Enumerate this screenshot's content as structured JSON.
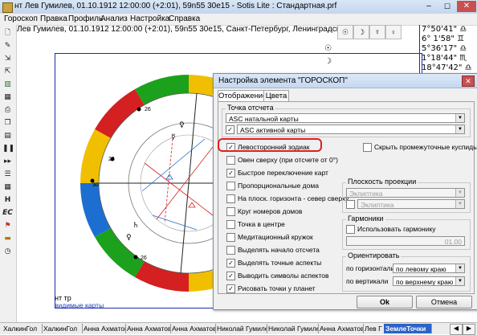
{
  "window": {
    "title": "нт Лев Гумилев, 01.10.1912 12:00:00 (+2:01), 59n55 30e15 - Sotis Lite : Стандартная.prf",
    "controls": [
      "minimize",
      "maximize",
      "close"
    ]
  },
  "menu": [
    "Гороскоп",
    "Правка",
    "Профиль",
    "Анализ",
    "Настройка",
    "Справка"
  ],
  "header": {
    "chart_info": "Лев Гумилев, 01.10.1912 12:00:00 (+2:01), 59n55 30e15, Санкт-Петербург, Ленинградская обл., Рос"
  },
  "chart": {
    "footer_title": "нт тр",
    "footer_sub": "видимые карты",
    "planet_labels": [
      "26",
      "26",
      "30",
      "26"
    ]
  },
  "right_panel": {
    "header_symbols": [
      "☉",
      "☽",
      "☿",
      "♀"
    ],
    "rows": [
      {
        "glyph": "☉",
        "pos": "7°50'41\"",
        "sign": "♎"
      },
      {
        "glyph": "☽",
        "pos": "6° 1'58\"",
        "sign": "♊"
      },
      {
        "glyph": "☿",
        "pos": "5°36'17\"",
        "sign": "♎"
      },
      {
        "glyph": "♀",
        "pos": "1°18'44\"",
        "sign": "♏"
      },
      {
        "glyph": "♂",
        "pos": "18°47'42\"",
        "sign": "♎"
      }
    ]
  },
  "dialog": {
    "title": "Настройка элемента \"ГОРОСКОП\"",
    "tabs": [
      "Отображение",
      "Цвета"
    ],
    "reference_group": {
      "label": "Точка отсчета",
      "combo1": "ASC натальной карты",
      "combo2": "ASC активной карты"
    },
    "options_left": [
      {
        "label": "Левосторонний зодиак",
        "checked": true
      },
      {
        "label": "Овен сверху (при отсчете от 0°)",
        "checked": false
      },
      {
        "label": "Быстрое переключение карт",
        "checked": true
      },
      {
        "label": "Пропорциональные дома",
        "checked": false
      },
      {
        "label": "На плоск. горизонта - север сверху",
        "checked": false
      },
      {
        "label": "Круг номеров домов",
        "checked": false
      },
      {
        "label": "Точка в центре",
        "checked": false
      },
      {
        "label": "Медитационный кружок",
        "checked": false
      },
      {
        "label": "Выделять начало отсчета",
        "checked": false
      },
      {
        "label": "Выделять точные аспекты",
        "checked": true
      },
      {
        "label": "Выводить символы аспектов",
        "checked": true
      },
      {
        "label": "Рисовать точки у планет",
        "checked": true
      }
    ],
    "hide_cusps_label": "Скрыть промежуточные куспиды",
    "projection": {
      "label": "Плоскость проекции",
      "combo1": "Эклиптика",
      "combo2": "Эклиптика"
    },
    "harmonics": {
      "label": "Гармоники",
      "checkbox": "Использовать гармонику",
      "value": "01.00"
    },
    "orient": {
      "label": "Ориентировать",
      "horizontal_label": "по горизонтали",
      "horizontal_value": "по левому краю",
      "vertical_label": "по вертикали",
      "vertical_value": "по верхнему краю"
    },
    "ok": "Ok",
    "cancel": "Отмена"
  },
  "bottom_tabs": [
    "ХалкинГол",
    "ХалкинГол",
    "Анна Ахматова",
    "Анна Ахматова",
    "Анна Ахматова",
    "Николай Гумилев",
    "Николай Гумилев",
    "Анна Ахматова",
    "Лев Г",
    "ЗемлеТочки"
  ],
  "colors": {
    "frame": "#1b2bb0",
    "highlight": "#e02020",
    "active_tab": "#2b63c9"
  }
}
